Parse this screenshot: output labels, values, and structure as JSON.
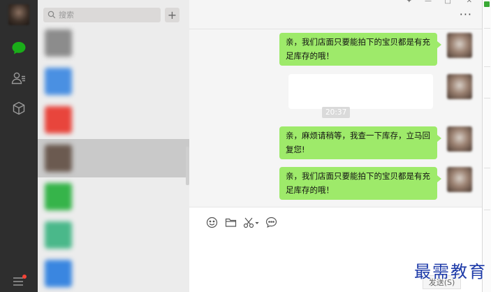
{
  "search": {
    "placeholder": "搜索",
    "add_label": "+"
  },
  "conversations": [
    {
      "name": "",
      "preview": "",
      "time": "",
      "avatar_color": "#8c8c8c",
      "active": false
    },
    {
      "name": "",
      "preview": "",
      "time": "",
      "avatar_color": "#4a90e2",
      "active": false
    },
    {
      "name": "",
      "preview": "",
      "time": "",
      "avatar_color": "#e8453c",
      "active": false
    },
    {
      "name": "",
      "preview": "",
      "time": "",
      "avatar_color": "#6b5a50",
      "active": true
    },
    {
      "name": "",
      "preview": "",
      "time": "",
      "avatar_color": "#36b44a",
      "active": false
    },
    {
      "name": "",
      "preview": "",
      "time": "",
      "avatar_color": "#4ab88a",
      "active": false
    },
    {
      "name": "",
      "preview": "",
      "time": "",
      "avatar_color": "#3a86e0",
      "active": false
    }
  ],
  "chat": {
    "title": "",
    "more_label": "···",
    "messages": [
      {
        "type": "text",
        "text": "亲，我们店面只要能拍下的宝贝都是有充足库存的哦！"
      },
      {
        "type": "image",
        "text": ""
      },
      {
        "type": "text",
        "text": "亲，麻烦请稍等，我查一下库存，立马回复您!"
      },
      {
        "type": "text",
        "text": "亲，我们店面只要能拍下的宝贝都是有充足库存的哦！"
      }
    ],
    "timestamp": "20:37",
    "send_label": "发送(S)"
  },
  "watermark": "最需教育",
  "colors": {
    "bubble": "#9eea6a",
    "rail": "#2e2e2e",
    "list": "#ececec",
    "chat_bg": "#f5f5f5",
    "accent": "#1aad19"
  },
  "icons": {
    "rail": [
      "chat-icon",
      "contacts-icon",
      "favorites-cube-icon",
      "menu-icon"
    ],
    "toolbar": [
      "emoji-icon",
      "folder-icon",
      "scissors-icon",
      "chat-history-icon"
    ]
  }
}
